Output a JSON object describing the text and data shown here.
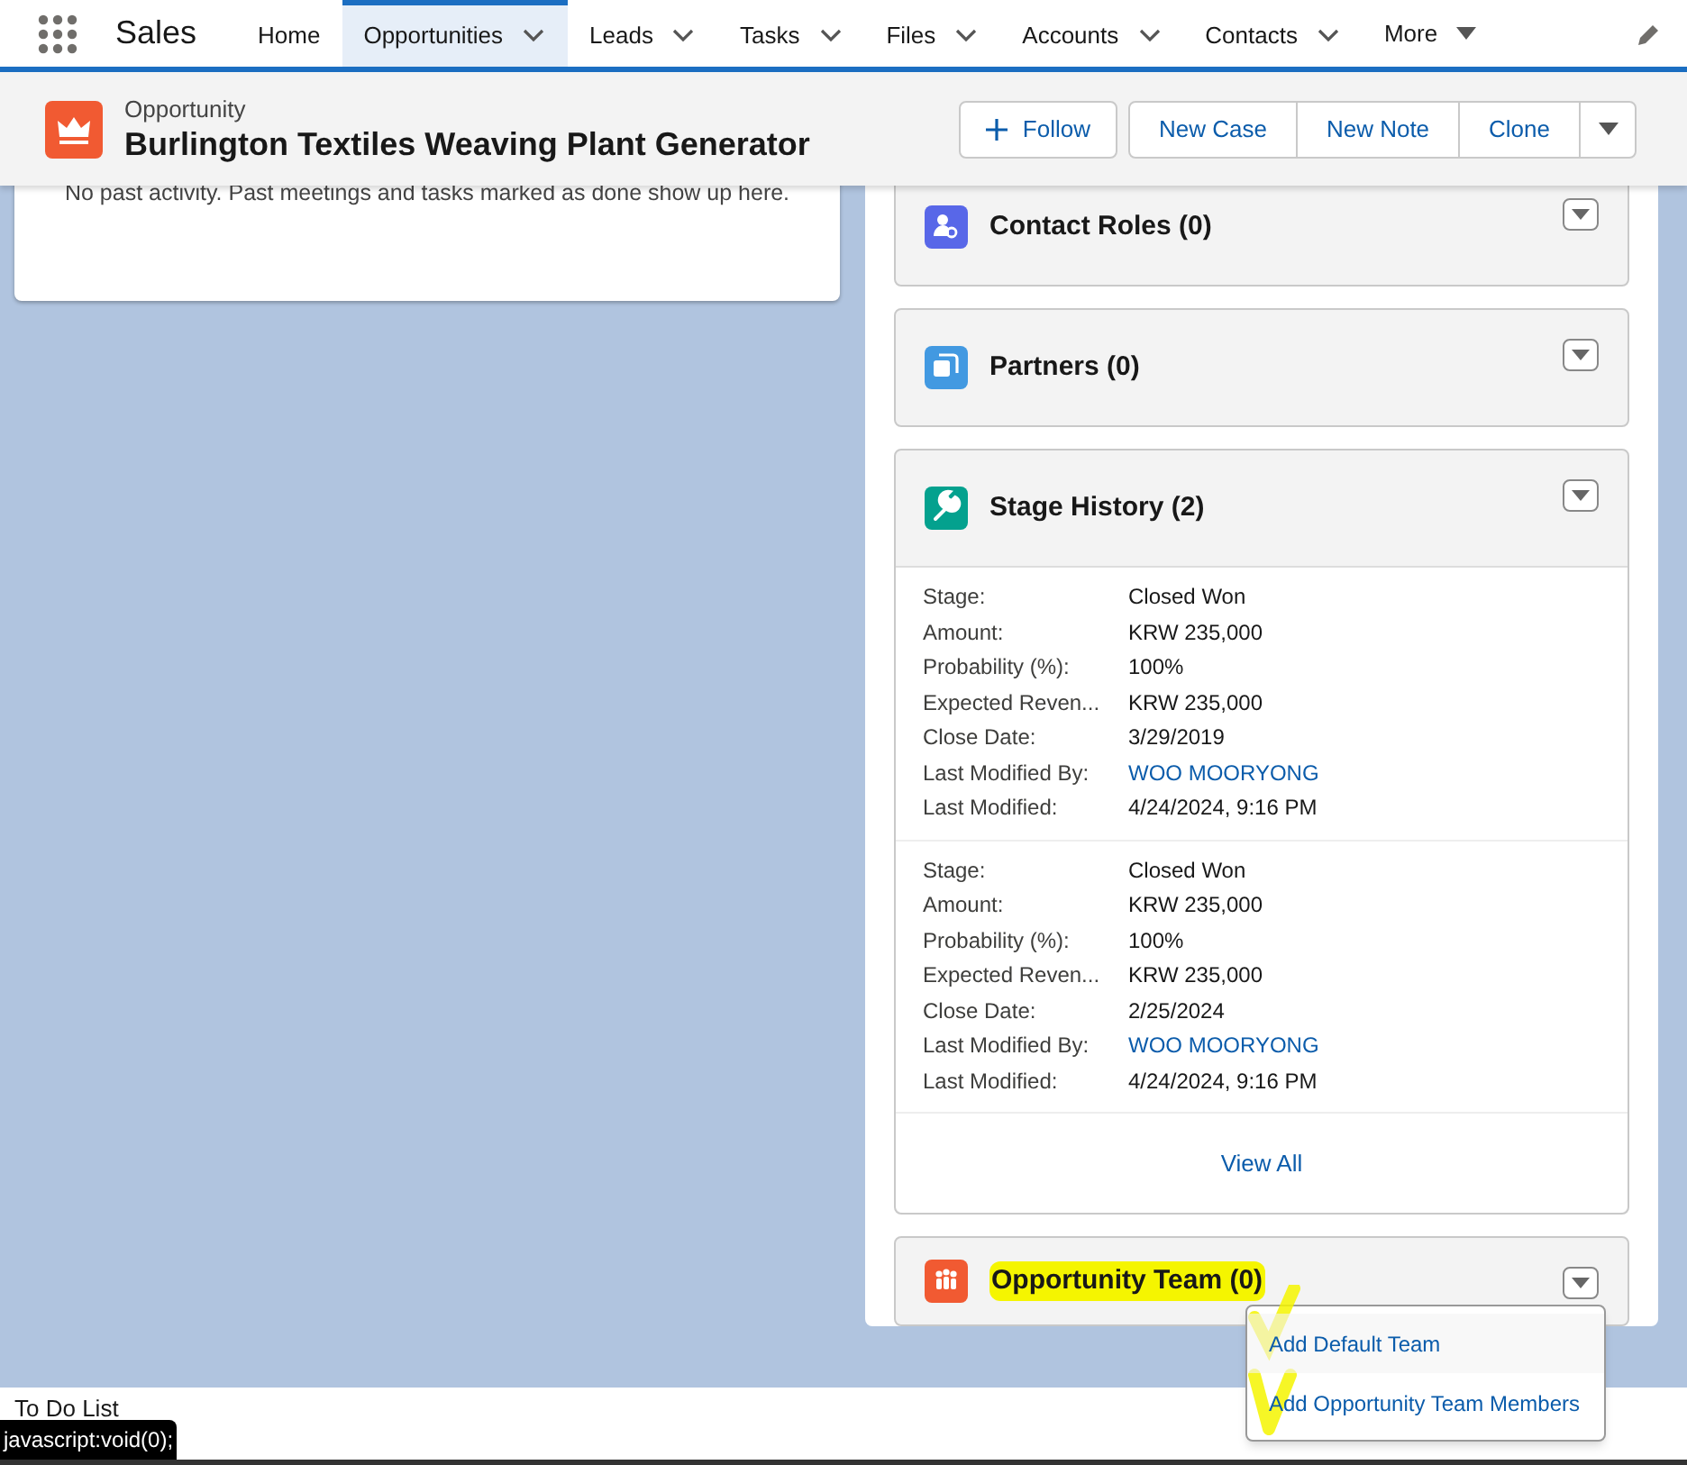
{
  "app": {
    "name": "Sales"
  },
  "nav_items": [
    {
      "label": "Home",
      "selected": false,
      "dropdown": false
    },
    {
      "label": "Opportunities",
      "selected": true,
      "dropdown": true
    },
    {
      "label": "Leads",
      "selected": false,
      "dropdown": true
    },
    {
      "label": "Tasks",
      "selected": false,
      "dropdown": true
    },
    {
      "label": "Files",
      "selected": false,
      "dropdown": true
    },
    {
      "label": "Accounts",
      "selected": false,
      "dropdown": true
    },
    {
      "label": "Contacts",
      "selected": false,
      "dropdown": true
    }
  ],
  "more": {
    "label": "More"
  },
  "header": {
    "object_type": "Opportunity",
    "title": "Burlington Textiles Weaving Plant Generator",
    "follow": "Follow",
    "actions": [
      "New Case",
      "New Note",
      "Clone"
    ]
  },
  "activity": {
    "empty_message": "No past activity. Past meetings and tasks marked as done show up here."
  },
  "related_lists": [
    {
      "kind": "contact",
      "title": "Contact Roles (0)",
      "color": "#5867e8"
    },
    {
      "kind": "partner",
      "title": "Partners (0)",
      "color": "#4299e1"
    },
    {
      "kind": "stage",
      "title": "Stage History (2)",
      "color": "#04a18e"
    }
  ],
  "stage_history": {
    "records": [
      {
        "fields": [
          {
            "label": "Stage:",
            "value": "Closed Won",
            "link": false
          },
          {
            "label": "Amount:",
            "value": "KRW 235,000",
            "link": false
          },
          {
            "label": "Probability (%):",
            "value": "100%",
            "link": false
          },
          {
            "label": "Expected Reven...",
            "value": "KRW 235,000",
            "link": false
          },
          {
            "label": "Close Date:",
            "value": "3/29/2019",
            "link": false
          },
          {
            "label": "Last Modified By:",
            "value": "WOO MOORYONG",
            "link": true
          },
          {
            "label": "Last Modified:",
            "value": "4/24/2024, 9:16 PM",
            "link": false
          }
        ]
      },
      {
        "fields": [
          {
            "label": "Stage:",
            "value": "Closed Won",
            "link": false
          },
          {
            "label": "Amount:",
            "value": "KRW 235,000",
            "link": false
          },
          {
            "label": "Probability (%):",
            "value": "100%",
            "link": false
          },
          {
            "label": "Expected Reven...",
            "value": "KRW 235,000",
            "link": false
          },
          {
            "label": "Close Date:",
            "value": "2/25/2024",
            "link": false
          },
          {
            "label": "Last Modified By:",
            "value": "WOO MOORYONG",
            "link": true
          },
          {
            "label": "Last Modified:",
            "value": "4/24/2024, 9:16 PM",
            "link": false
          }
        ]
      }
    ],
    "view_all": "View All"
  },
  "team": {
    "title": "Opportunity Team (0)",
    "color": "#f15a32",
    "menu": [
      {
        "label": "Add Default Team",
        "selected": true
      },
      {
        "label": "Add Opportunity Team Members",
        "selected": false
      }
    ]
  },
  "utility_bar": {
    "item": "To Do List"
  },
  "status_tooltip": "javascript:void(0);"
}
